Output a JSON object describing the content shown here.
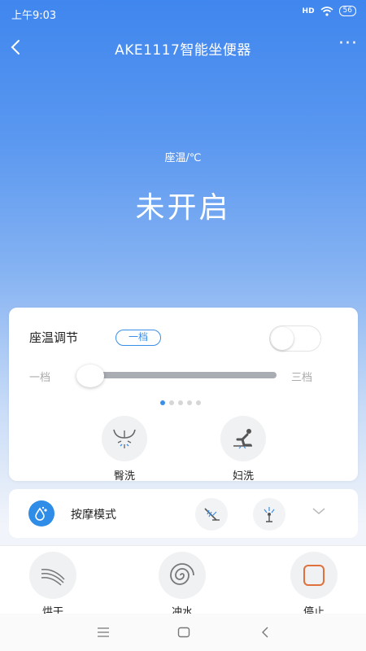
{
  "status_bar": {
    "time": "上午9:03",
    "signal": "HD",
    "battery": "56"
  },
  "header": {
    "title": "AKE1117智能坐便器",
    "more": "···"
  },
  "hero": {
    "temp_label": "座温/℃",
    "status": "未开启"
  },
  "seat_temp": {
    "title": "座温调节",
    "level_badge": "一档",
    "toggle_on": false,
    "slider_min": "一档",
    "slider_max": "三档",
    "slider_value_fraction": 0.0,
    "pages": 5,
    "active_page": 0
  },
  "wash_modes": [
    {
      "label": "臀洗",
      "icon": "rear-wash-icon"
    },
    {
      "label": "妇洗",
      "icon": "feminine-wash-icon"
    }
  ],
  "massage": {
    "label": "按摩模式",
    "icon": "water-drop-icon",
    "modes": [
      "massage-spray-icon",
      "massage-person-icon"
    ]
  },
  "actions": [
    {
      "label": "烘干",
      "icon": "dry-icon"
    },
    {
      "label": "冲水",
      "icon": "flush-icon"
    },
    {
      "label": "停止",
      "icon": "stop-icon"
    }
  ],
  "colors": {
    "accent": "#3a8fe8",
    "stop": "#e0703c",
    "hero_top": "#3f86ee"
  }
}
